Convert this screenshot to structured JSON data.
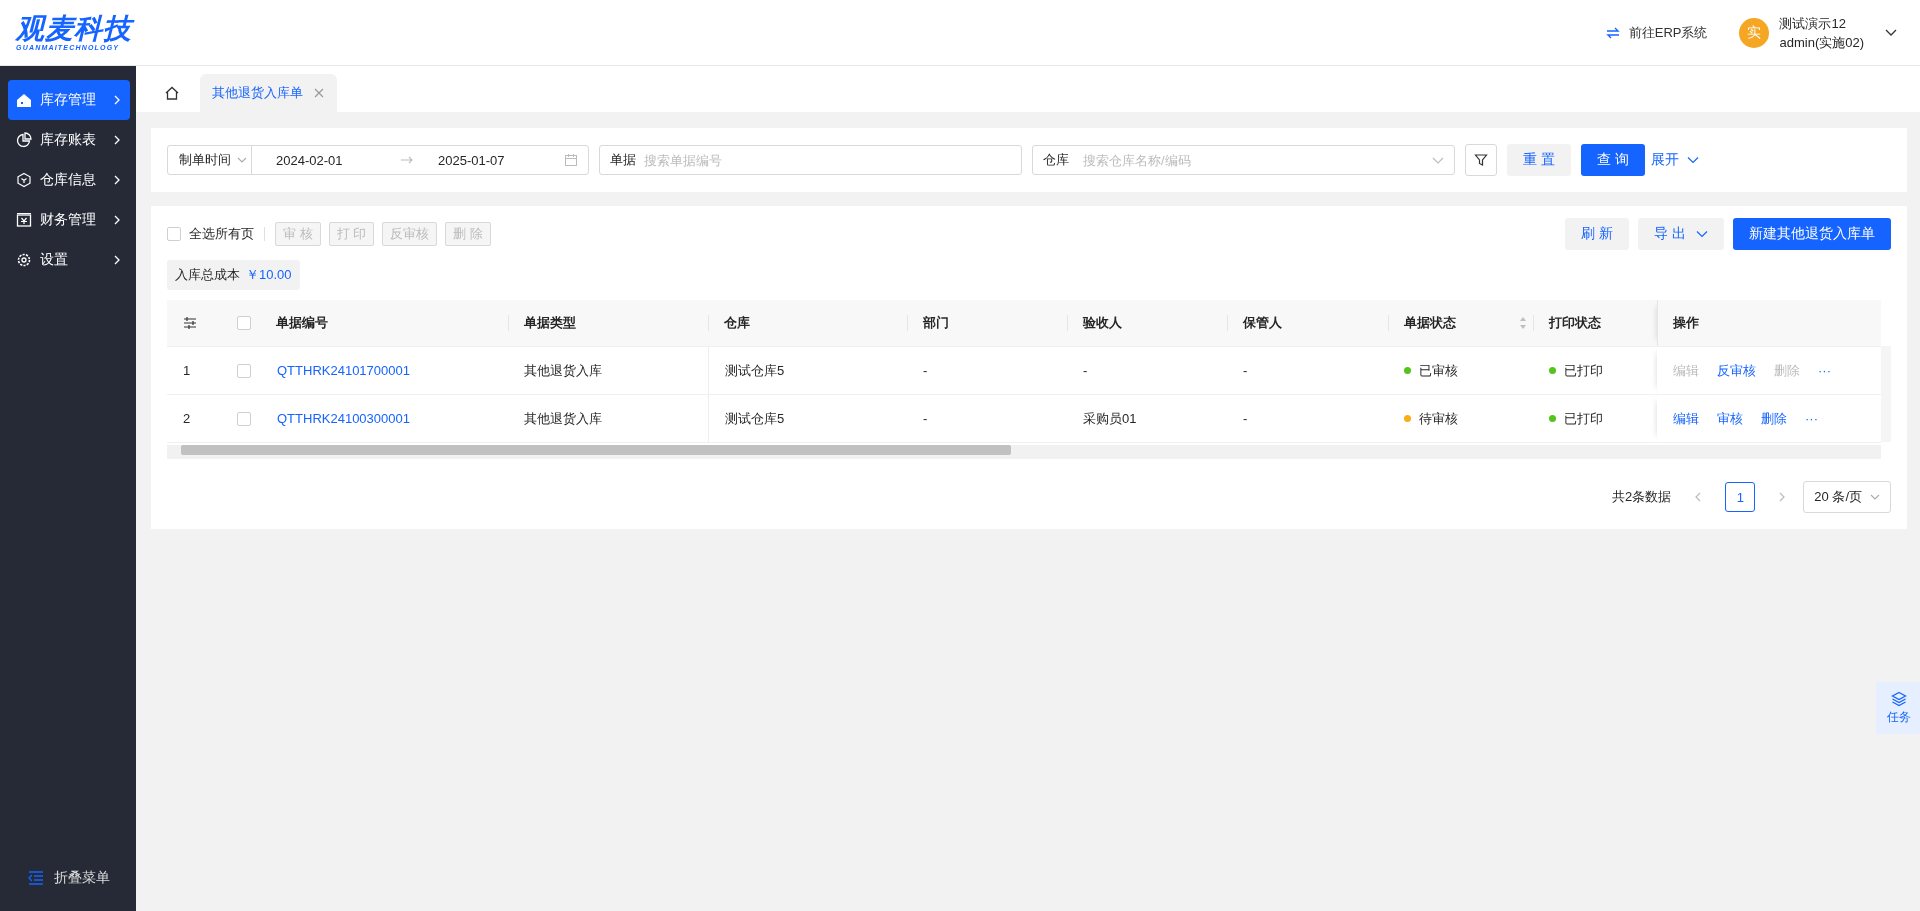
{
  "logo": {
    "title": "观麦科技",
    "subtitle": "GUANMAITECHNOLOGY"
  },
  "header": {
    "erp_link": "前往ERP系统",
    "user": {
      "avatar": "实",
      "name": "测试演示12",
      "role": "admin(实施02)"
    }
  },
  "sidebar": {
    "items": [
      {
        "label": "库存管理",
        "selected": true
      },
      {
        "label": "库存账表",
        "selected": false
      },
      {
        "label": "仓库信息",
        "selected": false
      },
      {
        "label": "财务管理",
        "selected": false
      },
      {
        "label": "设置",
        "selected": false
      }
    ],
    "collapse": "折叠菜单"
  },
  "tabs": [
    {
      "label": "其他退货入库单",
      "selected": true
    }
  ],
  "filters": {
    "date_type": "制单时间",
    "start": "2024-02-01",
    "end": "2025-01-07",
    "doc_label": "单据",
    "doc_placeholder": "搜索单据编号",
    "warehouse_label": "仓库",
    "warehouse_placeholder": "搜索仓库名称/编码",
    "reset": "重 置",
    "query": "查 询",
    "expand": "展开"
  },
  "toolbar": {
    "select_all": {
      "label": "全选所有页",
      "checked": false
    },
    "batch": [
      {
        "label": "审 核",
        "disabled": true
      },
      {
        "label": "打 印",
        "disabled": true
      },
      {
        "label": "反审核",
        "disabled": true
      },
      {
        "label": "删 除",
        "disabled": true
      }
    ],
    "refresh": "刷 新",
    "export": "导 出",
    "create": "新建其他退货入库单"
  },
  "summary": {
    "label": "入库总成本",
    "value": "￥10.00"
  },
  "table": {
    "all_checked": false,
    "columns": [
      "单据编号",
      "单据类型",
      "仓库",
      "部门",
      "验收人",
      "保管人",
      "单据状态",
      "打印状态",
      "操作"
    ],
    "rows": [
      {
        "index": "1",
        "checked": false,
        "code": "QTTHRK24101700001",
        "type": "其他退货入库",
        "warehouse": "测试仓库5",
        "dept": "-",
        "receiver": "-",
        "keeper": "-",
        "status": {
          "text": "已审核",
          "color": "#52c41a"
        },
        "print": {
          "text": "已打印",
          "color": "#52c41a"
        },
        "actions": [
          {
            "label": "编辑",
            "disabled": true
          },
          {
            "label": "反审核",
            "disabled": false
          },
          {
            "label": "删除",
            "disabled": true
          }
        ],
        "more": "···"
      },
      {
        "index": "2",
        "checked": false,
        "code": "QTTHRK24100300001",
        "type": "其他退货入库",
        "warehouse": "测试仓库5",
        "dept": "-",
        "receiver": "采购员01",
        "keeper": "-",
        "status": {
          "text": "待审核",
          "color": "#faad14"
        },
        "print": {
          "text": "已打印",
          "color": "#52c41a"
        },
        "actions": [
          {
            "label": "编辑",
            "disabled": false
          },
          {
            "label": "审核",
            "disabled": false
          },
          {
            "label": "删除",
            "disabled": false
          }
        ],
        "more": "···"
      }
    ]
  },
  "pagination": {
    "total": "共2条数据",
    "pages": [
      {
        "label": "1",
        "selected": true
      }
    ],
    "page_size": "20 条/页"
  },
  "task_button": "任务"
}
